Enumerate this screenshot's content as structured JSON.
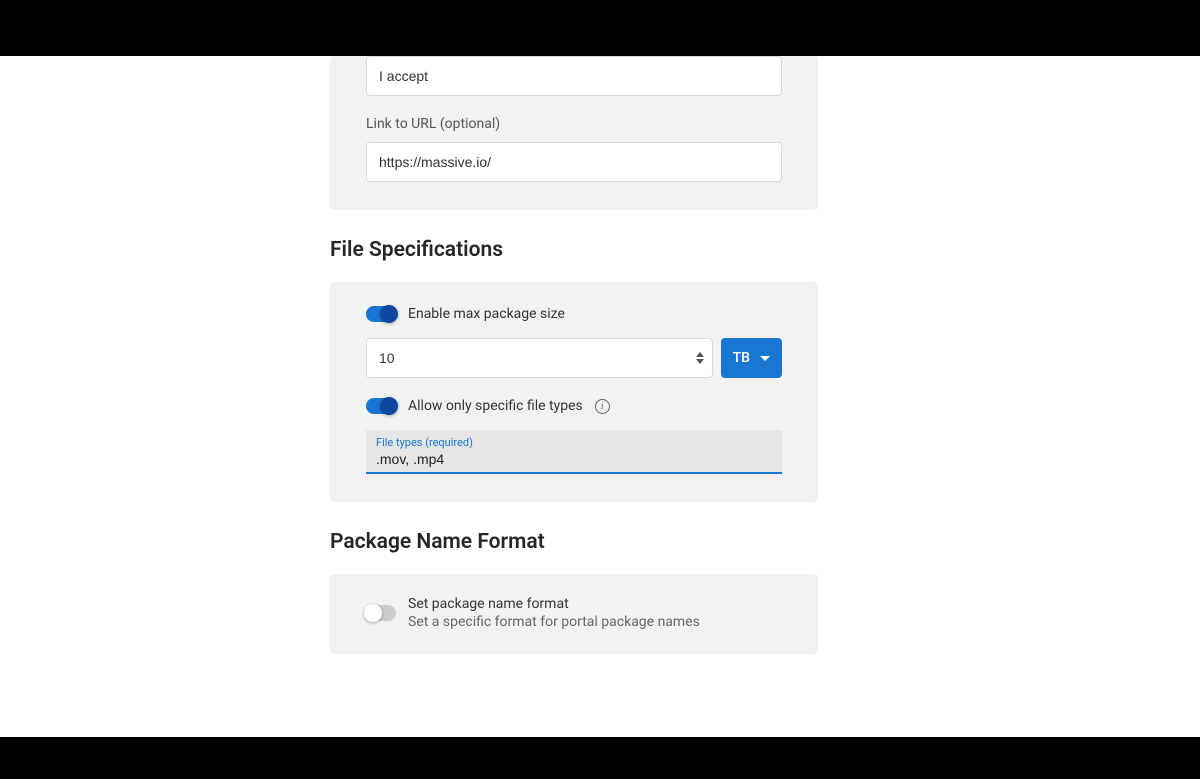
{
  "agreement": {
    "accept_value": "I accept",
    "link_label": "Link to URL (optional)",
    "link_value": "https://massive.io/"
  },
  "file_spec": {
    "title": "File Specifications",
    "enable_max_label": "Enable max package size",
    "max_value": "10",
    "unit": "TB",
    "allow_types_label": "Allow only specific file types",
    "types_field_label": "File types (required)",
    "types_value": ".mov, .mp4"
  },
  "pkg_name": {
    "title": "Package Name Format",
    "toggle_label": "Set package name format",
    "toggle_desc": "Set a specific format for portal package names"
  }
}
